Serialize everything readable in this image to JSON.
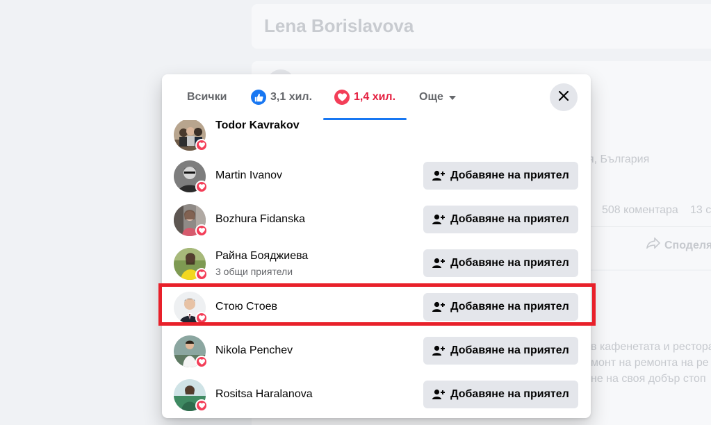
{
  "background": {
    "profile_name": "Lena Borislavova",
    "location_fragment": "я, България",
    "comments_count": "508 коментара",
    "shares_fragment": "13 с",
    "share_label": "Споделя",
    "post_lines": [
      "в кафенетата и рестора",
      "монт на ремонта на ре",
      "не на своя добър стоп"
    ]
  },
  "modal": {
    "tabs": {
      "all_label": "Всички",
      "like_count": "3,1 хил.",
      "love_count": "1,4 хил.",
      "more_label": "Още",
      "active_tab": "love"
    },
    "accent_color": "#1877f2",
    "love_color": "#e41e3f",
    "people": [
      {
        "name": "Todor Kavrakov",
        "mutual": "",
        "button": "",
        "avatar_icon": "group-photo-avatar"
      },
      {
        "name": "Martin Ivanov",
        "mutual": "",
        "button": "Добавяне на приятел",
        "avatar_icon": "person-avatar"
      },
      {
        "name": "Bozhura Fidanska",
        "mutual": "",
        "button": "Добавяне на приятел",
        "avatar_icon": "person-avatar"
      },
      {
        "name": "Райна Бояджиева",
        "mutual": "3 общи приятели",
        "button": "Добавяне на приятел",
        "avatar_icon": "person-avatar"
      },
      {
        "name": "Стою Стоев",
        "mutual": "",
        "button": "Добавяне на приятел",
        "avatar_icon": "person-avatar"
      },
      {
        "name": "Nikola Penchev",
        "mutual": "",
        "button": "Добавяне на приятел",
        "avatar_icon": "person-avatar"
      },
      {
        "name": "Rositsa Haralanova",
        "mutual": "",
        "button": "Добавяне на приятел",
        "avatar_icon": "person-avatar"
      }
    ],
    "highlighted_person": "Стою Стоев"
  }
}
